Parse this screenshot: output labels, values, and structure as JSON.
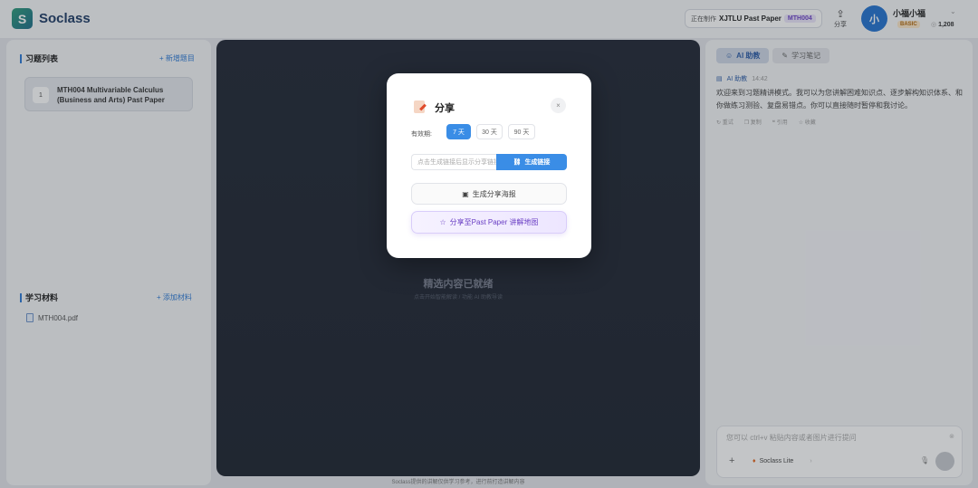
{
  "header": {
    "logo_letter": "S",
    "logo_text": "Soclass",
    "now_label": "正在制作",
    "now_paper": "XJTLU Past Paper",
    "now_tag": "MTH004",
    "share_label": "分享",
    "avatar_letter": "小",
    "user_name": "小福小福",
    "plan_badge": "BASIC",
    "coin_count": "1,208"
  },
  "left": {
    "problems_title": "习题列表",
    "add_problem": "+ 新增题目",
    "problems": [
      {
        "num": "1",
        "title": "MTH004 Multivariable Calculus (Business and Arts) Past Paper"
      }
    ],
    "materials_title": "学习材料",
    "add_material": "+ 添加材料",
    "files": [
      {
        "name": "MTH004.pdf"
      }
    ]
  },
  "center": {
    "ready_title": "精选内容已就绪",
    "ready_sub": "点击开始智能解读 / 功能 AI 助教导读",
    "footer_note": "Soclass提供的讲解仅供学习参考，进行前打造讲解内容"
  },
  "right": {
    "tabs": [
      {
        "label": "AI 助教",
        "icon": "robot-icon"
      },
      {
        "label": "学习笔记",
        "icon": "note-icon"
      }
    ],
    "ai_name": "AI 助教",
    "ai_time": "14:42",
    "ai_message": "欢迎来到习题精讲模式。我可以为您讲解困难知识点、逐步解构知识体系、和你做练习测验、复盘易错点。你可以直接随时暂停和我讨论。",
    "actions": [
      "重试",
      "复制",
      "引用",
      "收藏"
    ],
    "chat_placeholder": "您可以 ctrl+v 粘贴内容或者图片进行提问",
    "model_name": "Soclass Lite"
  },
  "modal": {
    "title": "分享",
    "close": "×",
    "valid_label": "有效期:",
    "durations": [
      "7 天",
      "30 天",
      "90 天"
    ],
    "selected_duration": "7 天",
    "link_placeholder": "点击生成链接后显示分享链接",
    "generate_link": "生成链接",
    "poster_button": "生成分享海报",
    "map_button": "分享至Past Paper 讲解地图"
  },
  "colors": {
    "accent": "#3a8de6",
    "brand": "#1f3c66",
    "purple": "#6a3fc4"
  }
}
